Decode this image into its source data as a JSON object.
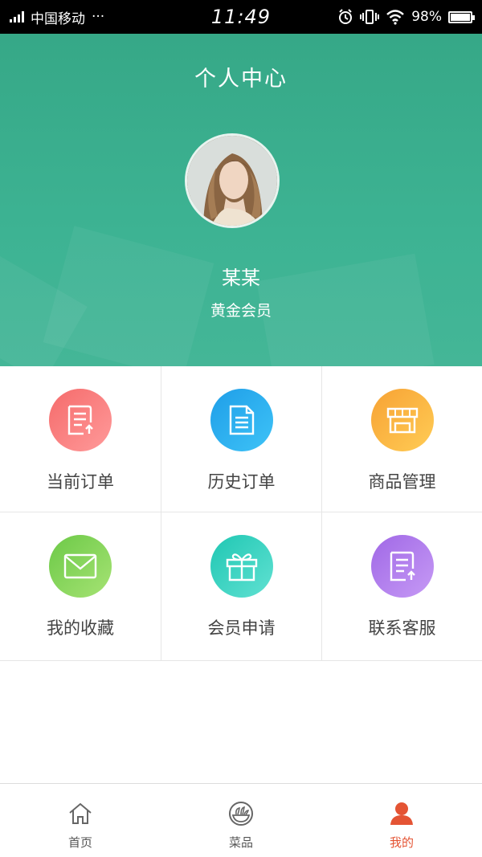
{
  "status_bar": {
    "carrier": "中国移动",
    "dots": "···",
    "time": "11:49",
    "battery": "98%",
    "battery_level": 0.98
  },
  "header": {
    "title": "个人中心",
    "user_name": "某某",
    "member_level": "黄金会员"
  },
  "menu": {
    "items": [
      {
        "label": "当前订单",
        "color_from": "#f56b6b",
        "color_to": "#ff9a9a",
        "icon": "order-upload-icon"
      },
      {
        "label": "历史订单",
        "color_from": "#1f9ee8",
        "color_to": "#3ec3f7",
        "icon": "document-icon"
      },
      {
        "label": "商品管理",
        "color_from": "#f7a234",
        "color_to": "#ffcc55",
        "icon": "shop-icon"
      },
      {
        "label": "我的收藏",
        "color_from": "#6cc947",
        "color_to": "#a6e374",
        "icon": "mail-icon"
      },
      {
        "label": "会员申请",
        "color_from": "#1fc7b3",
        "color_to": "#61e1d2",
        "icon": "gift-icon"
      },
      {
        "label": "联系客服",
        "color_from": "#a068e6",
        "color_to": "#c69af5",
        "icon": "document-upload-icon"
      }
    ]
  },
  "bottom_nav": {
    "items": [
      {
        "label": "首页",
        "icon": "home-icon"
      },
      {
        "label": "菜品",
        "icon": "dish-icon"
      },
      {
        "label": "我的",
        "icon": "user-icon",
        "active": true
      }
    ],
    "active_color": "#e45434"
  }
}
